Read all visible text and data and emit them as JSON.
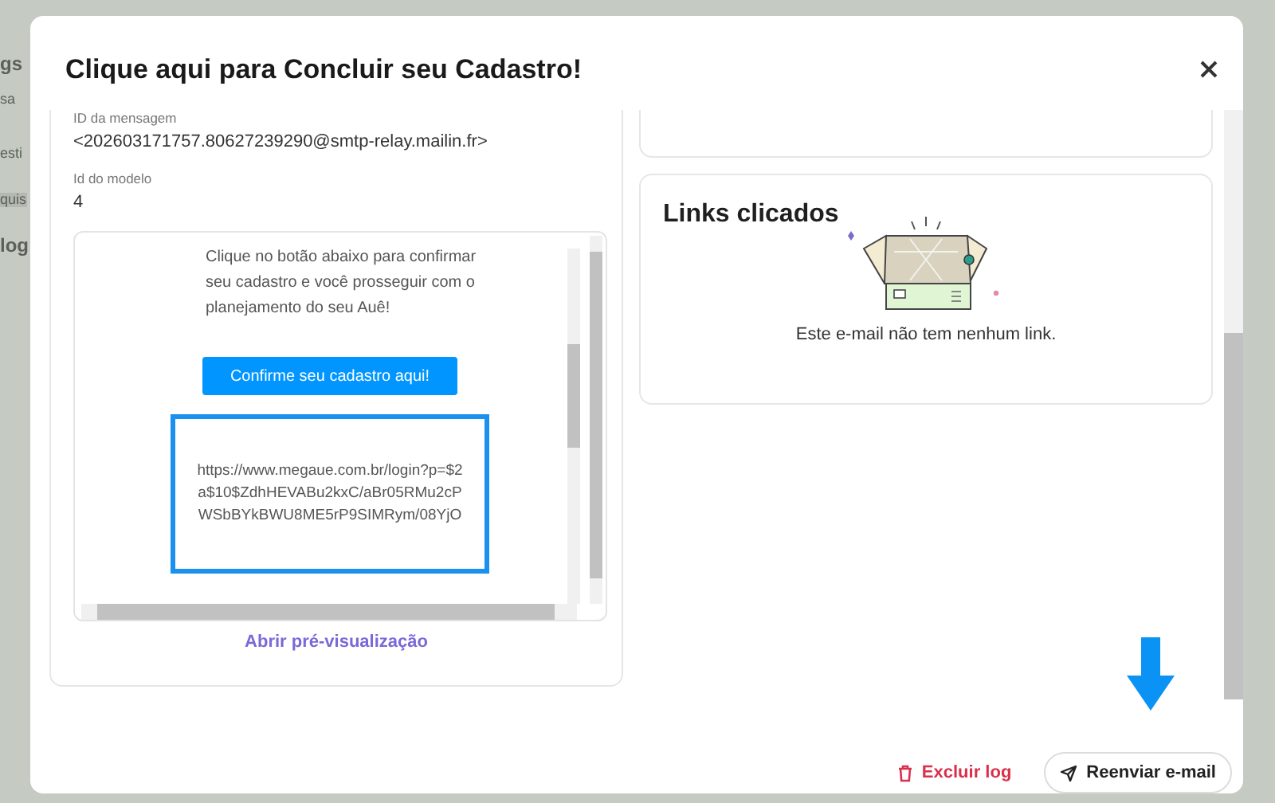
{
  "background": {
    "fragments": [
      "gs",
      "sa",
      "esti",
      "quis",
      "log"
    ]
  },
  "modal": {
    "title": "Clique aqui para Concluir seu Cadastro!",
    "fields": [
      {
        "label": "ID da mensagem",
        "value": "<202603171757.80627239290@smtp-relay.mailin.fr>"
      },
      {
        "label": "Id do modelo",
        "value": "4"
      }
    ],
    "email_preview": {
      "paragraph": "Clique no botão abaixo para confirmar seu cadastro e você prosseguir com o planejamento do seu Auê!",
      "button": "Confirme seu cadastro aqui!",
      "link_text": "https://www.megaue.com.br/login?p=$2a$10$ZdhHEVABu2kxC/aBr05RMu2cPWSbBYkBWU8ME5rP9SIMRym/08YjO"
    },
    "preview_link": "Abrir pré-visualização",
    "links_card": {
      "title": "Links clicados",
      "empty_message": "Este e-mail não tem nenhum link."
    },
    "footer": {
      "delete_button": "Excluir log",
      "resend_button": "Reenviar e-mail"
    }
  }
}
